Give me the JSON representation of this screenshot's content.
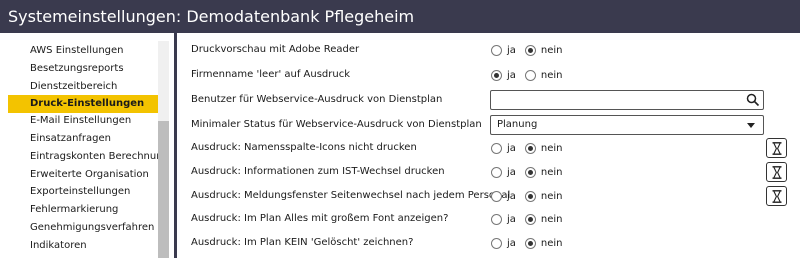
{
  "window": {
    "title": "Systemeinstellungen: Demodatenbank Pflegeheim"
  },
  "sidebar": {
    "items": [
      {
        "label": "AWS Einstellungen"
      },
      {
        "label": "Besetzungsreports"
      },
      {
        "label": "Dienstzeitbereich"
      },
      {
        "label": "Druck-Einstellungen",
        "active": true
      },
      {
        "label": "E-Mail Einstellungen"
      },
      {
        "label": "Einsatzanfragen"
      },
      {
        "label": "Eintragskonten Berechnung"
      },
      {
        "label": "Erweiterte Organisation"
      },
      {
        "label": "Exporteinstellungen"
      },
      {
        "label": "Fehlermarkierung"
      },
      {
        "label": "Genehmigungsverfahren"
      },
      {
        "label": "Indikatoren"
      }
    ]
  },
  "radio_labels": {
    "yes": "ja",
    "no": "nein"
  },
  "settings": [
    {
      "label": "Druckvorschau mit Adobe Reader",
      "value": "nein"
    },
    {
      "label": "Firmenname 'leer' auf Ausdruck",
      "value": "ja"
    },
    {
      "label": "Benutzer für Webservice-Ausdruck von Dienstplan",
      "input_value": ""
    },
    {
      "label": "Minimaler Status für Webservice-Ausdruck von Dienstplan",
      "select_value": "Planung"
    },
    {
      "label": "Ausdruck: Namensspalte-Icons nicht drucken",
      "value": "nein"
    },
    {
      "label": "Ausdruck: Informationen zum IST-Wechsel drucken",
      "value": "nein"
    },
    {
      "label": "Ausdruck: Meldungsfenster Seitenwechsel nach jedem Personal",
      "value": "nein"
    },
    {
      "label": "Ausdruck: Im Plan Alles mit großem Font anzeigen?",
      "value": "nein"
    },
    {
      "label": "Ausdruck: Im Plan KEIN 'Gelöscht' zeichnen?",
      "value": "nein"
    }
  ]
}
